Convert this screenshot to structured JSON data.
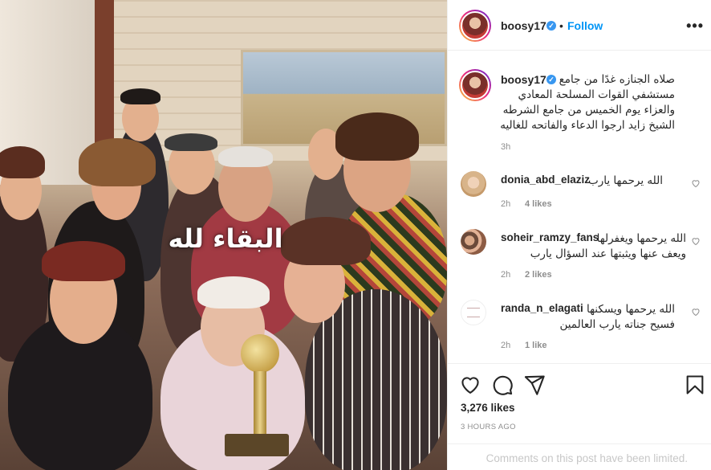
{
  "photo": {
    "overlay_text": "البقاء لله",
    "alt": ""
  },
  "header": {
    "username": "boosy17",
    "separator": "•",
    "follow_label": "Follow",
    "more_icon": "more-horizontal-icon"
  },
  "caption": {
    "username": "boosy17",
    "lines": [
      "صلاه الجنازه غدًا من جامع",
      "مستشفي القوات المسلحة المعادي",
      "والعزاء يوم الخميس من جامع الشرطه",
      "الشيخ زايد ارجوا الدعاء والفاتحه للغاليه"
    ],
    "time": "3h"
  },
  "comments": [
    {
      "username": "donia_abd_elaziz",
      "lines": [
        "الله يرحمها يارب"
      ],
      "time": "2h",
      "likes": "4 likes"
    },
    {
      "username": "soheir_ramzy_fans",
      "lines": [
        "الله يرحمها ويغفرلها",
        "ويعف عنها ويثبتها عند السؤال يارب"
      ],
      "time": "2h",
      "likes": "2 likes"
    },
    {
      "username": "randa_n_elagati",
      "lines": [
        "الله يرحمها ويسكنها",
        "فسيح جناته يارب العالمين"
      ],
      "time": "2h",
      "likes": "1 like"
    }
  ],
  "actions": {
    "like_icon": "heart-icon",
    "comment_icon": "comment-icon",
    "share_icon": "send-icon",
    "save_icon": "bookmark-icon",
    "likes_count": "3,276 likes",
    "posted_ago": "3 HOURS AGO",
    "comments_notice": "Comments on this post have been limited."
  },
  "colors": {
    "link_blue": "#0095f6",
    "verified_blue": "#3897f0",
    "muted_text": "#8e8e8e",
    "border": "#efefef"
  }
}
